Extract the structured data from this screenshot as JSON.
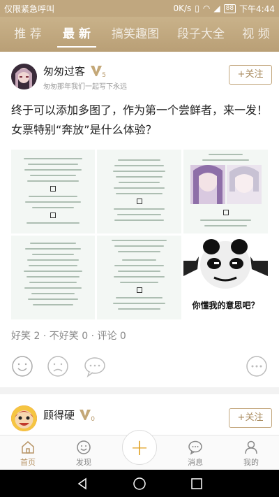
{
  "status_bar": {
    "left_text": "仅限紧急呼叫",
    "speed": "0K/s",
    "battery": "88",
    "time": "下午4:44"
  },
  "tabs": [
    {
      "label": "推 荐",
      "active": false
    },
    {
      "label": "最 新",
      "active": true
    },
    {
      "label": "搞笑趣图",
      "active": false
    },
    {
      "label": "段子大全",
      "active": false
    },
    {
      "label": "视 频",
      "active": false
    }
  ],
  "post": {
    "user": {
      "name": "匆匆过客",
      "level": "5",
      "signature": "匆匆那年我们一起写下永远"
    },
    "follow_label": "+关注",
    "text": "终于可以添加多图了，作为第一个尝鲜者，来一发！女票特别“奔放”是什么体验？",
    "meme_caption": "你懂我的意思吧？",
    "stats": {
      "likes_label": "好笑",
      "likes": "2",
      "dislikes_label": "不好笑",
      "dislikes": "0",
      "comments_label": "评论",
      "comments": "0",
      "sep": "·"
    },
    "actions": [
      "smile-icon",
      "frown-icon",
      "comment-icon",
      "more-icon"
    ]
  },
  "post2": {
    "user": {
      "name": "顾得硬",
      "level": "0"
    },
    "follow_label": "+关注"
  },
  "bottom_nav": [
    {
      "label": "首页",
      "icon": "home-icon",
      "active": true
    },
    {
      "label": "发现",
      "icon": "discover-icon",
      "active": false
    },
    {
      "label": "消息",
      "icon": "message-icon",
      "active": false
    },
    {
      "label": "我的",
      "icon": "profile-icon",
      "active": false
    }
  ],
  "colors": {
    "accent": "#c0a77f",
    "accent_dark": "#a88a5d",
    "plus": "#e0a020"
  }
}
